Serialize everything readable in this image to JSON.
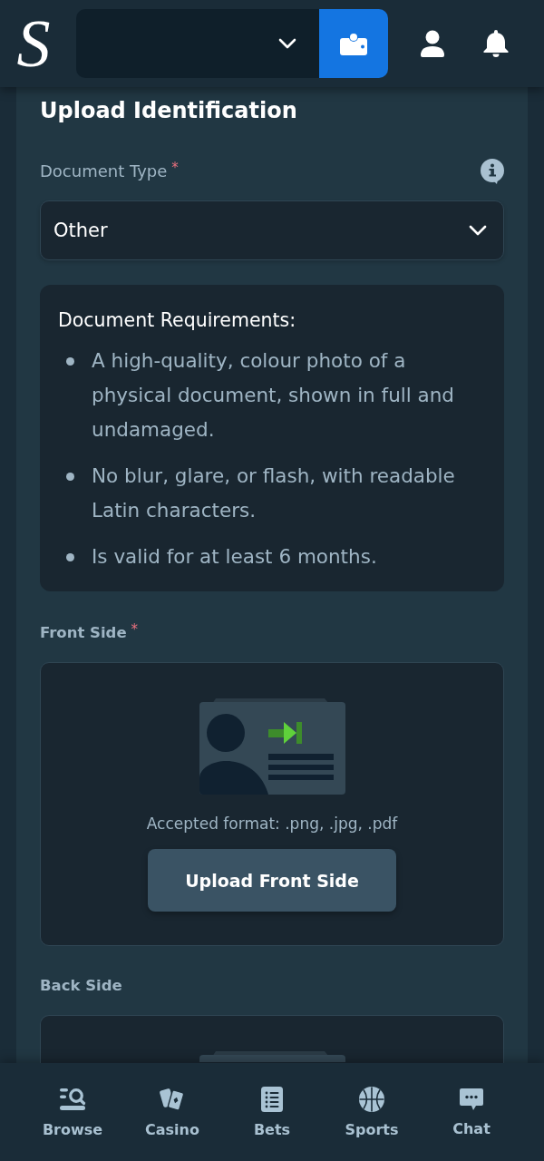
{
  "header": {
    "logo": "S"
  },
  "form": {
    "title": "Upload Identification",
    "document_type": {
      "label": "Document Type",
      "required_mark": "*",
      "value": "Other"
    },
    "requirements": {
      "title": "Document Requirements:",
      "items": [
        "A high-quality, colour photo of a physical document, shown in full and undamaged.",
        "No blur, glare, or flash, with readable Latin characters.",
        "Is valid for at least 6 months."
      ]
    },
    "uploads": [
      {
        "label": "Front Side",
        "required_mark": "*",
        "format_note": "Accepted format: .png, .jpg, .pdf",
        "button": "Upload Front Side"
      },
      {
        "label": "Back Side"
      }
    ]
  },
  "bottom_nav": [
    {
      "label": "Browse"
    },
    {
      "label": "Casino"
    },
    {
      "label": "Bets"
    },
    {
      "label": "Sports"
    },
    {
      "label": "Chat"
    }
  ]
}
